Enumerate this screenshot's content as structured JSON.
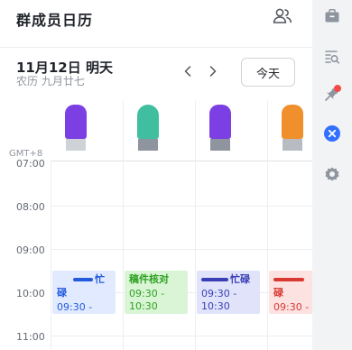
{
  "header": {
    "title": "群成员日历"
  },
  "date_bar": {
    "date": "11月12日 明天",
    "lunar": "农历 九月廿七",
    "today_label": "今天"
  },
  "timezone_label": "GMT+8",
  "hours": [
    "07:00",
    "08:00",
    "09:00",
    "10:00",
    "11:00"
  ],
  "avatars": [
    {
      "color": "#7b3fe4",
      "base": "#cfd2d6"
    },
    {
      "color": "#3fbf9f",
      "base": "#8f959e"
    },
    {
      "color": "#7b3fe4",
      "base": "#8f959e"
    },
    {
      "color": "#f0902d",
      "base": "#b8bcc2"
    }
  ],
  "events": [
    {
      "title": "忙碌",
      "time": "09:30 -",
      "bg": "#e1eaff",
      "fg": "#245bdb"
    },
    {
      "title": "稿件核对",
      "time": "09:30 - 10:30",
      "bg": "#d9f5d6",
      "fg": "#2ea121"
    },
    {
      "title": "忙碌",
      "time": "09:30 - 10:30",
      "bg": "#e0e3fa",
      "fg": "#3a3fb5"
    },
    {
      "title": "碌",
      "time": "09:30 -",
      "bg": "#fde2e2",
      "fg": "#d83931"
    }
  ],
  "sidebar": {
    "icons": [
      "briefcase-icon",
      "search-list-icon",
      "pin-icon",
      "close-icon",
      "settings-icon"
    ],
    "accent": "#3370ff",
    "badge_color": "#f54a45"
  }
}
